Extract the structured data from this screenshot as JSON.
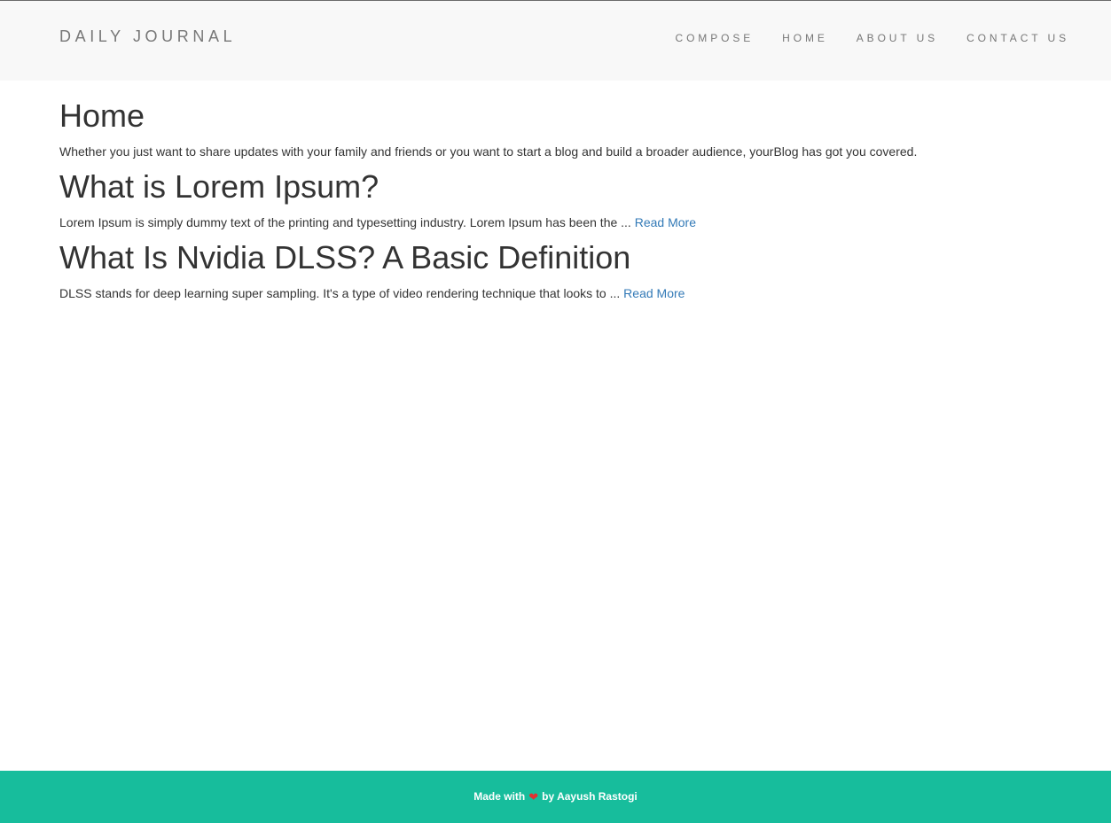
{
  "navbar": {
    "brand": "DAILY JOURNAL",
    "links": [
      "COMPOSE",
      "HOME",
      "ABOUT US",
      "CONTACT US"
    ]
  },
  "main": {
    "page_title": "Home",
    "intro": "Whether you just want to share updates with your family and friends or you want to start a blog and build a broader audience, yourBlog has got you covered.",
    "posts": [
      {
        "title": "What is Lorem Ipsum?",
        "excerpt": "Lorem Ipsum is simply dummy text of the printing and typesetting industry. Lorem Ipsum has been the ...",
        "read_more": "Read More"
      },
      {
        "title": "What Is Nvidia DLSS? A Basic Definition",
        "excerpt": "DLSS stands for deep learning super sampling. It's a type of video rendering technique that looks to ...",
        "read_more": "Read More"
      }
    ]
  },
  "footer": {
    "prefix": "Made with",
    "icon": "heart-icon",
    "suffix": "by Aayush Rastogi"
  },
  "colors": {
    "navbar_bg": "#f8f8f8",
    "nav_text": "#777777",
    "body_text": "#333333",
    "link": "#337ab7",
    "footer_bg": "#17bd9c",
    "heart": "#e03131"
  }
}
